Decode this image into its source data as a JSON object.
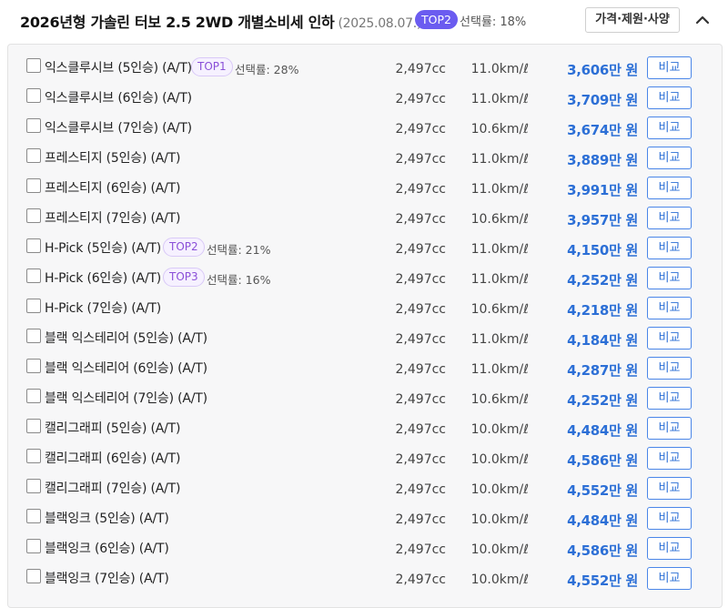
{
  "header": {
    "title": "2026년형 가솔린 터보 2.5 2WD 개별소비세 인하",
    "date": "(2025.08.07.)",
    "badge": "TOP2",
    "rate": "선택률: 18%",
    "spec_button": "가격·제원·사양"
  },
  "colors": {
    "accent": "#2c6fd6",
    "badge_fill": "#6b5cf0",
    "top_badge_text": "#8a4fd8"
  },
  "icons": {
    "collapse": "chevron-up-icon",
    "checkbox": "checkbox-icon"
  },
  "trims": [
    {
      "name": "익스클루시브 (5인승) (A/T)",
      "badge": "TOP1",
      "rate": "선택률: 28%",
      "displacement": "2,497cc",
      "efficiency": "11.0km/ℓ",
      "price": "3,606만 원",
      "compare": "비교"
    },
    {
      "name": "익스클루시브 (6인승) (A/T)",
      "badge": "",
      "rate": "",
      "displacement": "2,497cc",
      "efficiency": "11.0km/ℓ",
      "price": "3,709만 원",
      "compare": "비교"
    },
    {
      "name": "익스클루시브 (7인승) (A/T)",
      "badge": "",
      "rate": "",
      "displacement": "2,497cc",
      "efficiency": "10.6km/ℓ",
      "price": "3,674만 원",
      "compare": "비교"
    },
    {
      "name": "프레스티지 (5인승) (A/T)",
      "badge": "",
      "rate": "",
      "displacement": "2,497cc",
      "efficiency": "11.0km/ℓ",
      "price": "3,889만 원",
      "compare": "비교"
    },
    {
      "name": "프레스티지 (6인승) (A/T)",
      "badge": "",
      "rate": "",
      "displacement": "2,497cc",
      "efficiency": "11.0km/ℓ",
      "price": "3,991만 원",
      "compare": "비교"
    },
    {
      "name": "프레스티지 (7인승) (A/T)",
      "badge": "",
      "rate": "",
      "displacement": "2,497cc",
      "efficiency": "10.6km/ℓ",
      "price": "3,957만 원",
      "compare": "비교"
    },
    {
      "name": "H-Pick (5인승) (A/T)",
      "badge": "TOP2",
      "rate": "선택률: 21%",
      "displacement": "2,497cc",
      "efficiency": "11.0km/ℓ",
      "price": "4,150만 원",
      "compare": "비교"
    },
    {
      "name": "H-Pick (6인승) (A/T)",
      "badge": "TOP3",
      "rate": "선택률: 16%",
      "displacement": "2,497cc",
      "efficiency": "11.0km/ℓ",
      "price": "4,252만 원",
      "compare": "비교"
    },
    {
      "name": "H-Pick (7인승) (A/T)",
      "badge": "",
      "rate": "",
      "displacement": "2,497cc",
      "efficiency": "10.6km/ℓ",
      "price": "4,218만 원",
      "compare": "비교"
    },
    {
      "name": "블랙 익스테리어 (5인승) (A/T)",
      "badge": "",
      "rate": "",
      "displacement": "2,497cc",
      "efficiency": "11.0km/ℓ",
      "price": "4,184만 원",
      "compare": "비교"
    },
    {
      "name": "블랙 익스테리어 (6인승) (A/T)",
      "badge": "",
      "rate": "",
      "displacement": "2,497cc",
      "efficiency": "11.0km/ℓ",
      "price": "4,287만 원",
      "compare": "비교"
    },
    {
      "name": "블랙 익스테리어 (7인승) (A/T)",
      "badge": "",
      "rate": "",
      "displacement": "2,497cc",
      "efficiency": "10.6km/ℓ",
      "price": "4,252만 원",
      "compare": "비교"
    },
    {
      "name": "캘리그래피 (5인승) (A/T)",
      "badge": "",
      "rate": "",
      "displacement": "2,497cc",
      "efficiency": "10.0km/ℓ",
      "price": "4,484만 원",
      "compare": "비교"
    },
    {
      "name": "캘리그래피 (6인승) (A/T)",
      "badge": "",
      "rate": "",
      "displacement": "2,497cc",
      "efficiency": "10.0km/ℓ",
      "price": "4,586만 원",
      "compare": "비교"
    },
    {
      "name": "캘리그래피 (7인승) (A/T)",
      "badge": "",
      "rate": "",
      "displacement": "2,497cc",
      "efficiency": "10.0km/ℓ",
      "price": "4,552만 원",
      "compare": "비교"
    },
    {
      "name": "블랙잉크 (5인승) (A/T)",
      "badge": "",
      "rate": "",
      "displacement": "2,497cc",
      "efficiency": "10.0km/ℓ",
      "price": "4,484만 원",
      "compare": "비교"
    },
    {
      "name": "블랙잉크 (6인승) (A/T)",
      "badge": "",
      "rate": "",
      "displacement": "2,497cc",
      "efficiency": "10.0km/ℓ",
      "price": "4,586만 원",
      "compare": "비교"
    },
    {
      "name": "블랙잉크 (7인승) (A/T)",
      "badge": "",
      "rate": "",
      "displacement": "2,497cc",
      "efficiency": "10.0km/ℓ",
      "price": "4,552만 원",
      "compare": "비교"
    }
  ]
}
